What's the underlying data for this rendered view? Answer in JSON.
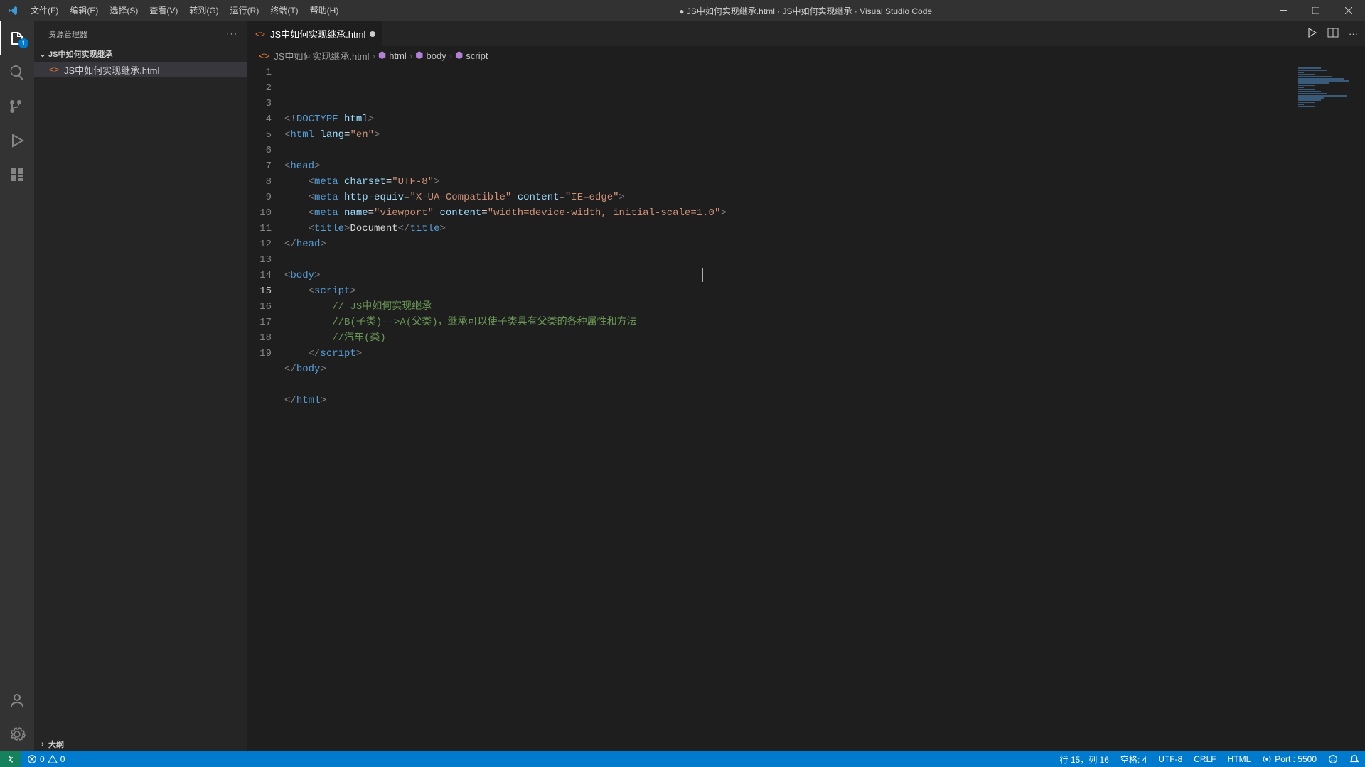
{
  "window": {
    "title": "● JS中如何实现继承.html · JS中如何实现继承 · Visual Studio Code"
  },
  "menu": {
    "file": "文件(F)",
    "edit": "编辑(E)",
    "select": "选择(S)",
    "view": "查看(V)",
    "go": "转到(G)",
    "run": "运行(R)",
    "terminal": "终端(T)",
    "help": "帮助(H)"
  },
  "activity": {
    "explorer_badge": "1"
  },
  "sidebar": {
    "title": "资源管理器",
    "actions": "···",
    "folder": "JS中如何实现继承",
    "files": [
      {
        "name": "JS中如何实现继承.html"
      }
    ],
    "outline": "大纲"
  },
  "tab": {
    "name": "JS中如何实现继承.html"
  },
  "breadcrumb": {
    "file": "JS中如何实现继承.html",
    "path": [
      "html",
      "body",
      "script"
    ]
  },
  "code": {
    "lines": [
      {
        "n": 1,
        "html": "<span class='tk-bracket'>&lt;!</span><span class='tk-doctype'>DOCTYPE</span> <span class='tk-attr'>html</span><span class='tk-bracket'>&gt;</span>"
      },
      {
        "n": 2,
        "html": "<span class='tk-bracket'>&lt;</span><span class='tk-tag'>html</span> <span class='tk-attr'>lang</span><span class='tk-text'>=</span><span class='tk-string'>\"en\"</span><span class='tk-bracket'>&gt;</span>"
      },
      {
        "n": 3,
        "html": ""
      },
      {
        "n": 4,
        "html": "<span class='tk-bracket'>&lt;</span><span class='tk-tag'>head</span><span class='tk-bracket'>&gt;</span>"
      },
      {
        "n": 5,
        "html": "    <span class='tk-bracket'>&lt;</span><span class='tk-tag'>meta</span> <span class='tk-attr'>charset</span><span class='tk-text'>=</span><span class='tk-string'>\"UTF-8\"</span><span class='tk-bracket'>&gt;</span>"
      },
      {
        "n": 6,
        "html": "    <span class='tk-bracket'>&lt;</span><span class='tk-tag'>meta</span> <span class='tk-attr'>http-equiv</span><span class='tk-text'>=</span><span class='tk-string'>\"X-UA-Compatible\"</span> <span class='tk-attr'>content</span><span class='tk-text'>=</span><span class='tk-string'>\"IE=edge\"</span><span class='tk-bracket'>&gt;</span>"
      },
      {
        "n": 7,
        "html": "    <span class='tk-bracket'>&lt;</span><span class='tk-tag'>meta</span> <span class='tk-attr'>name</span><span class='tk-text'>=</span><span class='tk-string'>\"viewport\"</span> <span class='tk-attr'>content</span><span class='tk-text'>=</span><span class='tk-string'>\"width=device-width, initial-scale=1.0\"</span><span class='tk-bracket'>&gt;</span>"
      },
      {
        "n": 8,
        "html": "    <span class='tk-bracket'>&lt;</span><span class='tk-tag'>title</span><span class='tk-bracket'>&gt;</span><span class='tk-text'>Document</span><span class='tk-bracket'>&lt;/</span><span class='tk-tag'>title</span><span class='tk-bracket'>&gt;</span>"
      },
      {
        "n": 9,
        "html": "<span class='tk-bracket'>&lt;/</span><span class='tk-tag'>head</span><span class='tk-bracket'>&gt;</span>"
      },
      {
        "n": 10,
        "html": ""
      },
      {
        "n": 11,
        "html": "<span class='tk-bracket'>&lt;</span><span class='tk-tag'>body</span><span class='tk-bracket'>&gt;</span>"
      },
      {
        "n": 12,
        "html": "    <span class='tk-bracket'>&lt;</span><span class='tk-tag'>script</span><span class='tk-bracket'>&gt;</span>"
      },
      {
        "n": 13,
        "html": "        <span class='tk-comment'>// JS中如何实现继承</span>"
      },
      {
        "n": 14,
        "html": "        <span class='tk-comment'>//B(子类)--&gt;A(父类)，继承可以使子类具有父类的各种属性和方法</span>"
      },
      {
        "n": 15,
        "html": "        <span class='tk-comment'>//汽车(类)</span>",
        "active": true
      },
      {
        "n": 16,
        "html": "    <span class='tk-bracket'>&lt;/</span><span class='tk-tag'>script</span><span class='tk-bracket'>&gt;</span>"
      },
      {
        "n": 17,
        "html": "<span class='tk-bracket'>&lt;/</span><span class='tk-tag'>body</span><span class='tk-bracket'>&gt;</span>"
      },
      {
        "n": 18,
        "html": ""
      },
      {
        "n": 19,
        "html": "<span class='tk-bracket'>&lt;/</span><span class='tk-tag'>html</span><span class='tk-bracket'>&gt;</span>"
      }
    ]
  },
  "status": {
    "errors": "0",
    "warnings": "0",
    "line_col": "行 15，列 16",
    "spaces": "空格: 4",
    "encoding": "UTF-8",
    "eol": "CRLF",
    "lang": "HTML",
    "port": "Port : 5500"
  }
}
